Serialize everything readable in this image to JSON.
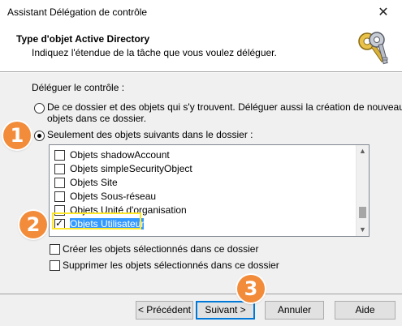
{
  "window": {
    "title": "Assistant Délégation de contrôle",
    "close_glyph": "✕"
  },
  "header": {
    "title": "Type d'objet Active Directory",
    "subtitle": "Indiquez l'étendue de la tâche que vous voulez déléguer.",
    "icon": "keys-icon"
  },
  "main": {
    "delegate_label": "Déléguer le contrôle :",
    "radio_all_line1": "De ce dossier et des objets qui s'y trouvent. Déléguer aussi la création de nouveaux",
    "radio_all_line2": "objets dans ce dossier.",
    "radio_all_checked": false,
    "radio_only": "Seulement des objets suivants dans le dossier :",
    "radio_only_checked": true
  },
  "object_list": [
    {
      "label": "Objets shadowAccount",
      "checked": false
    },
    {
      "label": "Objets simpleSecurityObject",
      "checked": false
    },
    {
      "label": "Objets Site",
      "checked": false
    },
    {
      "label": "Objets Sous-réseau",
      "checked": false
    },
    {
      "label": "Objets Unité d'organisation",
      "checked": false
    },
    {
      "label": "Objets Utilisateur",
      "checked": true
    }
  ],
  "options": {
    "create_label": "Créer les objets sélectionnés dans ce dossier",
    "create_checked": false,
    "delete_label": "Supprimer les objets sélectionnés dans ce dossier",
    "delete_checked": false
  },
  "buttons": {
    "previous": "< Précédent",
    "next": "Suivant >",
    "cancel": "Annuler",
    "help": "Aide"
  },
  "markers": {
    "one": "1",
    "two": "2",
    "three": "3",
    "color": "#f28c3b"
  },
  "colors": {
    "selection": "#3399ff",
    "highlight": "#ffe82a",
    "default_button_border": "#0078d7"
  }
}
